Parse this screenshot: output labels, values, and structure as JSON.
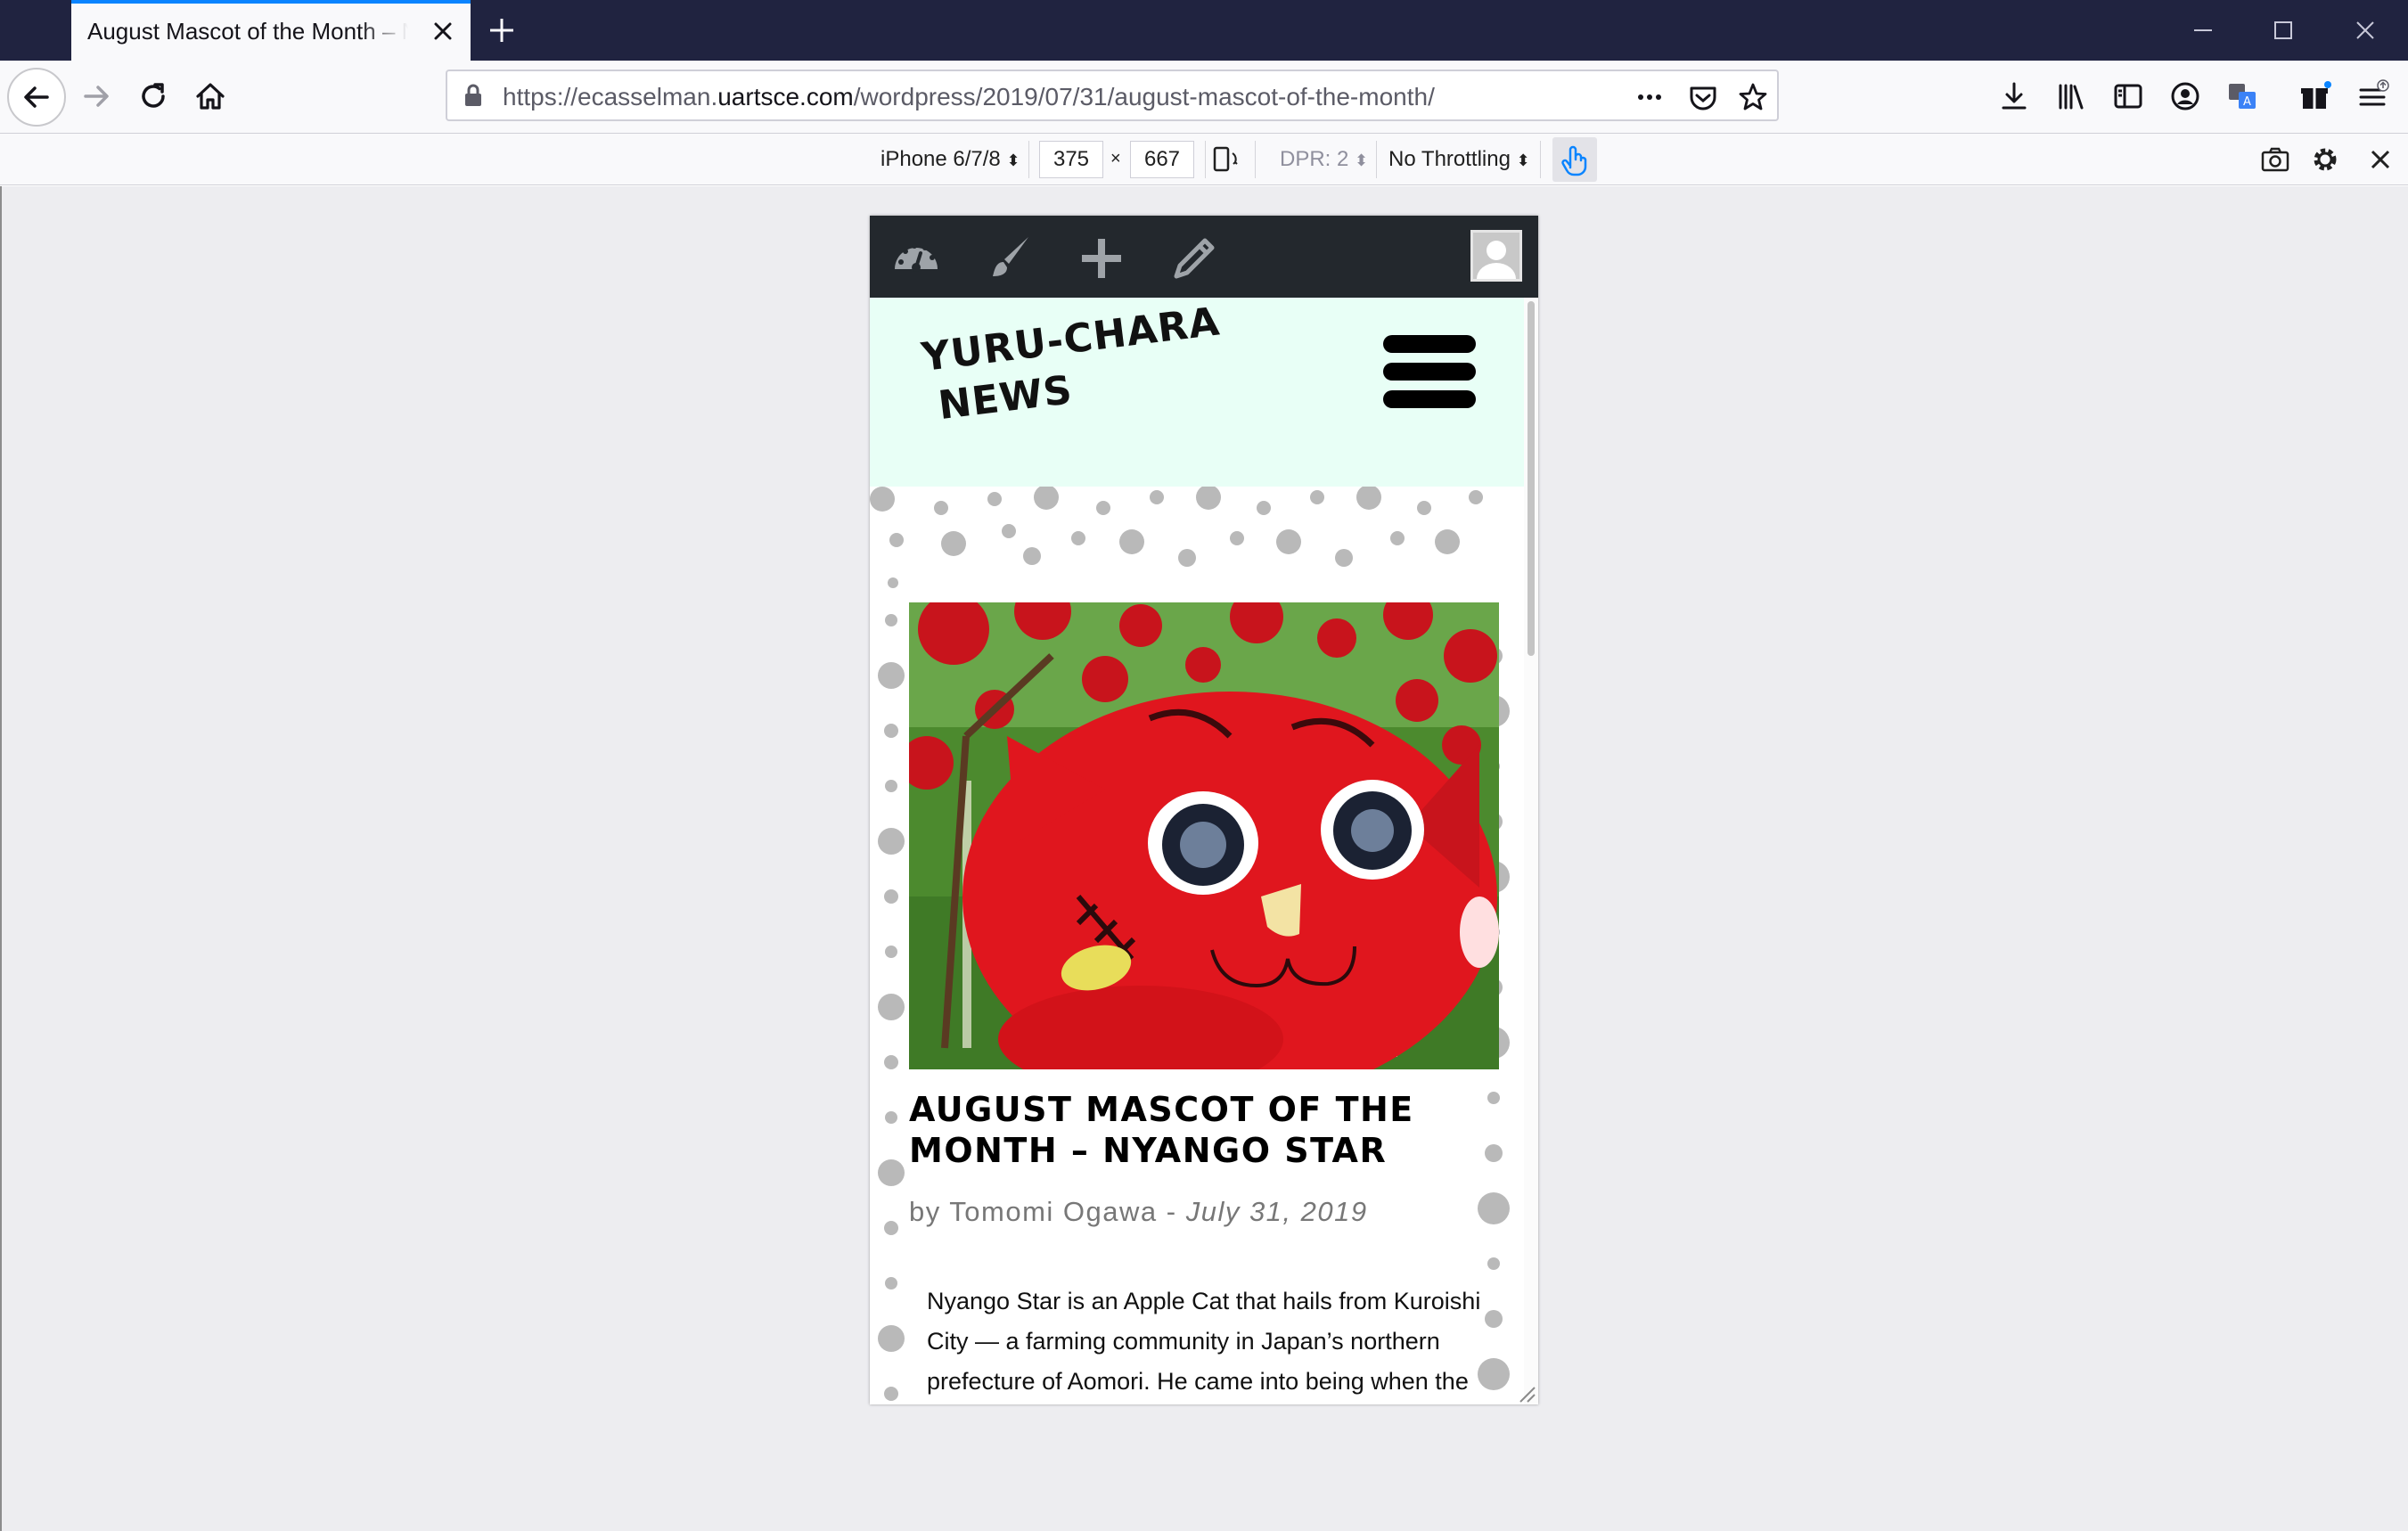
{
  "browser": {
    "tab_title": "August Mascot of the Month – Nyango Star – Yuru-Chara News",
    "url_prefix": "https://ecasselman.",
    "url_domain": "uartsce.com",
    "url_path": "/wordpress/2019/07/31/august-mascot-of-the-month/",
    "accent_color": "#0a84ff"
  },
  "responsive": {
    "device": "iPhone 6/7/8",
    "width": "375",
    "times": "×",
    "height": "667",
    "dpr": "DPR: 2",
    "throttling": "No Throttling"
  },
  "site": {
    "title_line1": "Yuru-Chara",
    "title_line2": "News",
    "header_color": "#e8fff6"
  },
  "post": {
    "title": "August Mascot of the Month – Nyango Star",
    "meta_by": "by Tomomi Ogawa - ",
    "meta_date": "July 31, 2019",
    "body": "Nyango Star is an Apple Cat that hails from Kuroishi City — a farming community in Japan’s northern prefecture of Aomori. He came into being when the"
  }
}
